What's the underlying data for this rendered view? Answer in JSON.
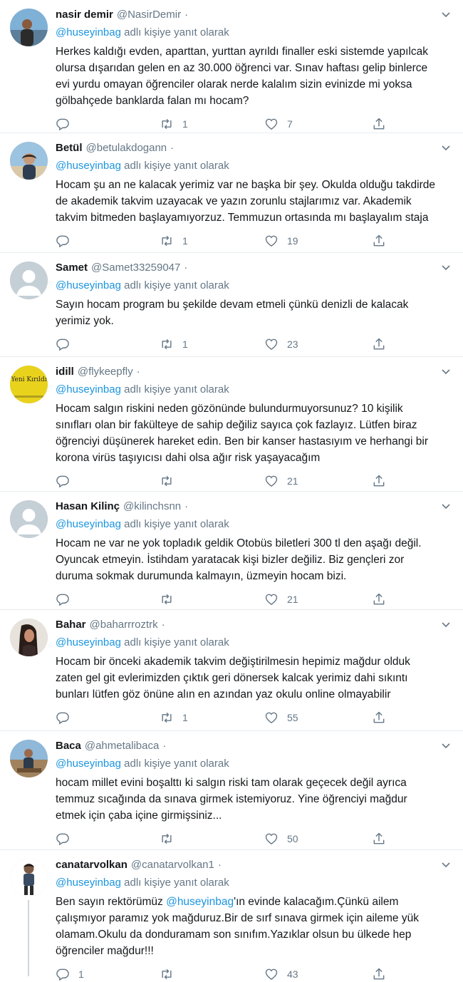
{
  "colors": {
    "link": "#1b95e0",
    "secondary_text": "#657786",
    "primary_text": "#14171a",
    "divider": "#e6ecf0"
  },
  "icons": {
    "reply": "reply-icon",
    "retweet": "retweet-icon",
    "like": "heart-icon",
    "share": "share-icon",
    "more": "chevron-down-icon"
  },
  "tweets": [
    {
      "name": "nasir demir",
      "handle": "@NasirDemir",
      "dot": "·",
      "reply_handle": "@huseyinbag",
      "reply_suffix": " adlı kişiye yanıt olarak",
      "lines": [
        "Herkes kaldığı evden, aparttan, yurttan ayrıldı finaller eski sistemde yapılcak",
        "olursa dışarıdan gelen en az 30.000 öğrenci var. Sınav haftası gelip binlerce",
        "evi yurdu omayan öğrenciler olarak nerde kalalım sizin evinizde mi yoksa",
        "gölbahçede banklarda falan mı hocam?"
      ],
      "replies": "",
      "retweets": "1",
      "likes": "7"
    },
    {
      "name": "Betül",
      "handle": "@betulakdogann",
      "dot": "·",
      "reply_handle": "@huseyinbag",
      "reply_suffix": " adlı kişiye yanıt olarak",
      "lines": [
        "Hocam şu an ne kalacak yerimiz var ne başka bir şey. Okulda olduğu takdirde",
        "de akademik takvim uzayacak ve yazın zorunlu stajlarımız var. Akademik",
        "takvim bitmeden başlayamıyorzuz. Temmuzun ortasında mı başlayalım staja"
      ],
      "replies": "",
      "retweets": "1",
      "likes": "19"
    },
    {
      "name": "Samet",
      "handle": "@Samet33259047",
      "dot": "·",
      "reply_handle": "@huseyinbag",
      "reply_suffix": " adlı kişiye yanıt olarak",
      "lines": [
        "Sayın hocam program bu şekilde devam etmeli çünkü denizli de kalacak",
        "yerimiz yok."
      ],
      "replies": "",
      "retweets": "1",
      "likes": "23"
    },
    {
      "name": "idill",
      "handle": "@flykeepfly",
      "dot": "·",
      "reply_handle": "@huseyinbag",
      "reply_suffix": " adlı kişiye yanıt olarak",
      "avatar_text": "Yeni Kırıldı",
      "lines": [
        "Hocam salgın riskini neden gözönünde bulundurmuyorsunuz? 10 kişilik",
        "sınıfları olan bir fakülteye de sahip değiliz sayıca çok fazlayız. Lütfen biraz",
        "öğrenciyi düşünerek hareket edin. Ben bir kanser hastasıyım ve herhangi bir",
        "korona virüs taşıyıcısı dahi olsa ağır risk yaşayacağım"
      ],
      "replies": "",
      "retweets": "",
      "likes": "21"
    },
    {
      "name": "Hasan Kilinç",
      "handle": "@kilinchsnn",
      "dot": "·",
      "reply_handle": "@huseyinbag",
      "reply_suffix": " adlı kişiye yanıt olarak",
      "lines": [
        "Hocam ne var ne yok topladık geldik Otobüs biletleri 300 tl den aşağı değil.",
        "Oyuncak etmeyin. İstihdam yaratacak kişi bizler değiliz. Biz gençleri zor",
        "duruma sokmak durumunda kalmayın, üzmeyin hocam bizi."
      ],
      "replies": "",
      "retweets": "",
      "likes": "21"
    },
    {
      "name": "Bahar",
      "handle": "@baharrroztrk",
      "dot": "·",
      "reply_handle": "@huseyinbag",
      "reply_suffix": " adlı kişiye yanıt olarak",
      "lines": [
        "Hocam bir önceki akademik takvim değiştirilmesin hepimiz mağdur olduk",
        "zaten gel git evlerimizden çıktık geri dönersek kalcak yerimiz dahi sıkıntı",
        "bunları lütfen göz önüne alın en azından yaz okulu online olmayabilir"
      ],
      "replies": "",
      "retweets": "1",
      "likes": "55"
    },
    {
      "name": "Baca",
      "handle": "@ahmetalibaca",
      "dot": "·",
      "reply_handle": "@huseyinbag",
      "reply_suffix": " adlı kişiye yanıt olarak",
      "lines": [
        "hocam millet evini boşalttı ki salgın riski tam olarak geçecek değil ayrıca",
        "temmuz sıcağında da sınava girmek istemiyoruz. Yine öğrenciyi mağdur",
        "etmek için çaba içine girmişsiniz..."
      ],
      "replies": "",
      "retweets": "",
      "likes": "50"
    },
    {
      "name": "canatarvolkan",
      "handle": "@canatarvolkan1",
      "dot": "·",
      "reply_handle": "@huseyinbag",
      "reply_suffix": " adlı kişiye yanıt olarak",
      "body_prefix": "Ben sayın rektörümüz ",
      "body_mention": "@huseyinbag",
      "body_suffix": "'ın evinde kalacağım.Çünkü ailem",
      "lines": [
        "çalışmıyor paramız yok mağduruz.Bir de sırf sınava girmek için aileme yük",
        "olamam.Okulu da donduramam son sınıfım.Yazıklar olsun bu ülkede hep",
        "öğrenciler mağdur!!!"
      ],
      "replies": "1",
      "retweets": "",
      "likes": "43"
    }
  ]
}
